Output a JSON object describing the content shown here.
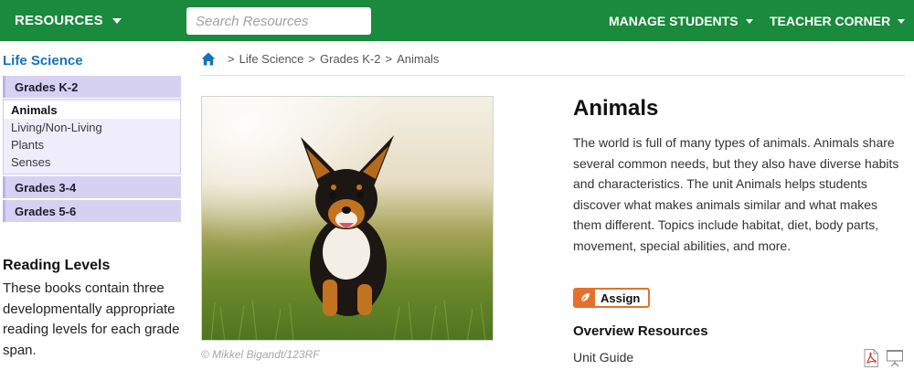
{
  "nav": {
    "resources": "RESOURCES",
    "search_placeholder": "Search Resources",
    "manage_students": "MANAGE STUDENTS",
    "teacher_corner": "TEACHER CORNER",
    "bar_color": "#1a8a3c"
  },
  "sidebar": {
    "title": "Life Science",
    "grades": [
      {
        "label": "Grades K-2",
        "expanded": true
      },
      {
        "label": "Grades 3-4",
        "expanded": false
      },
      {
        "label": "Grades 5-6",
        "expanded": false
      }
    ],
    "subitems": [
      {
        "label": "Animals",
        "active": true
      },
      {
        "label": "Living/Non-Living",
        "active": false
      },
      {
        "label": "Plants",
        "active": false
      },
      {
        "label": "Senses",
        "active": false
      }
    ],
    "reading_levels": {
      "heading": "Reading Levels",
      "text": "These books contain three developmentally appropriate reading levels for each grade span."
    }
  },
  "breadcrumb": {
    "items": [
      "Life Science",
      "Grades K-2",
      "Animals"
    ],
    "separator": ">"
  },
  "image": {
    "subject": "small dog running through grass",
    "credit": "© Mikkel Bigandt/123RF"
  },
  "content": {
    "title": "Animals",
    "description": "The world is full of many types of animals. Animals share several common needs, but they also have diverse habits and characteristics. The unit Animals helps students discover what makes animals similar and what makes them different. Topics include habitat, diet, body parts, movement, special abilities, and more.",
    "assign_label": "Assign",
    "overview_heading": "Overview Resources",
    "resources": [
      {
        "label": "Unit Guide",
        "icons": [
          "pdf-icon",
          "projector-icon"
        ]
      }
    ]
  },
  "colors": {
    "accent_blue": "#1673b5",
    "assign_orange": "#e3712c",
    "grade_tab": "#d7d1f1"
  }
}
